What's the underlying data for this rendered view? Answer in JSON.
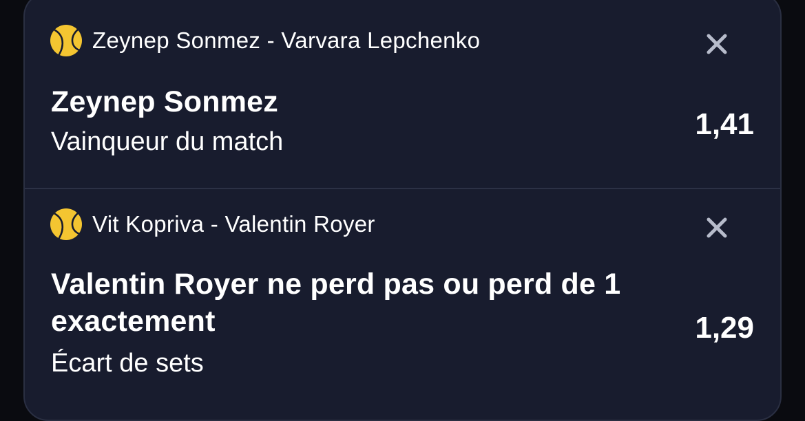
{
  "bets": [
    {
      "sport_icon": "tennis-ball-icon",
      "event": "Zeynep Sonmez - Varvara Lepchenko",
      "selection": "Zeynep Sonmez",
      "market": "Vainqueur du match",
      "odds": "1,41"
    },
    {
      "sport_icon": "tennis-ball-icon",
      "event": "Vit Kopriva - Valentin Royer",
      "selection": "Valentin Royer ne perd pas ou perd de 1 exactement",
      "market": "Écart de sets",
      "odds": "1,29"
    }
  ],
  "colors": {
    "background": "#0a0b10",
    "card": "#181c2e",
    "divider": "#2c3145",
    "text": "#ffffff",
    "close_icon": "#b7bccb",
    "ball": "#f4c531"
  }
}
